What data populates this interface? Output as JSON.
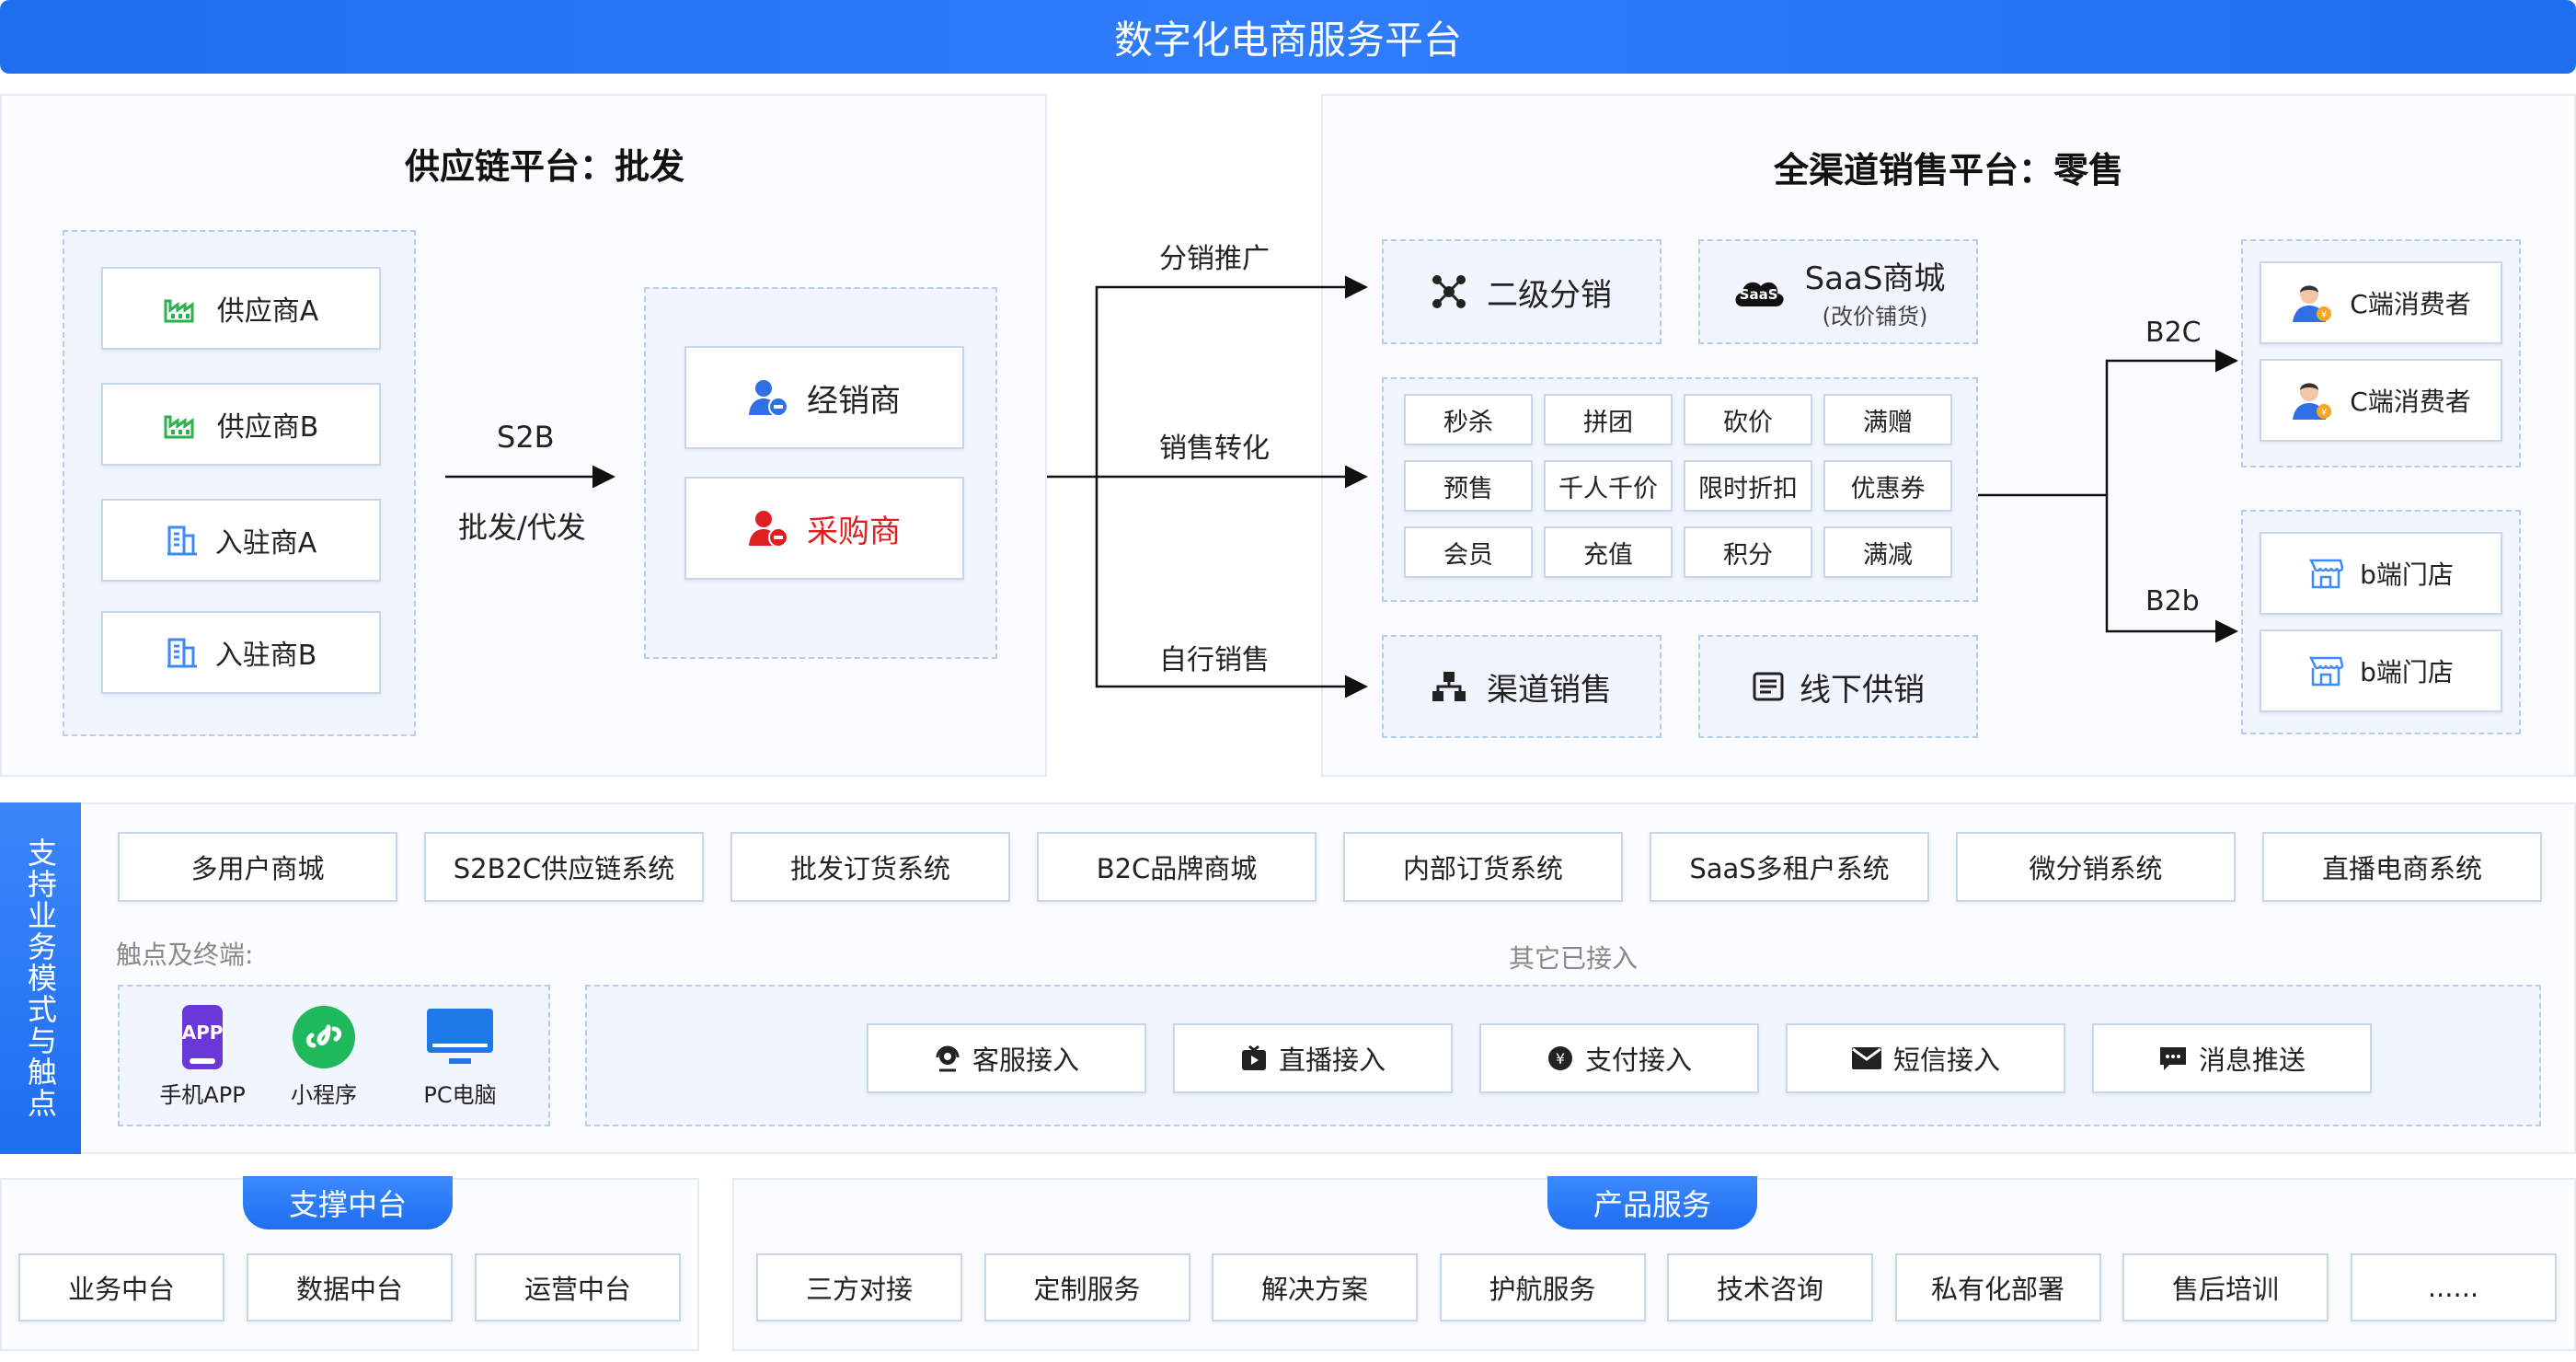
{
  "header": {
    "title": "数字化电商服务平台"
  },
  "supply": {
    "title": "供应链平台：批发",
    "suppliers": [
      "供应商A",
      "供应商B",
      "入驻商A",
      "入驻商B"
    ],
    "flow_top": "S2B",
    "flow_bottom": "批发/代发",
    "dealer": "经销商",
    "purchaser": "采购商"
  },
  "channels": {
    "distribution": "分销推广",
    "conversion": "销售转化",
    "self_sale": "自行销售"
  },
  "retail": {
    "title": "全渠道销售平台：零售",
    "second_level": "二级分销",
    "saas_title": "SaaS商城",
    "saas_sub": "(改价铺货)",
    "saas_badge": "SaaS",
    "promos": [
      "秒杀",
      "拼团",
      "砍价",
      "满赠",
      "预售",
      "千人千价",
      "限时折扣",
      "优惠券",
      "会员",
      "充值",
      "积分",
      "满减"
    ],
    "channel_sale": "渠道销售",
    "offline": "线下供销"
  },
  "targets": {
    "b2c": "B2C",
    "b2b": "B2b",
    "c_consumers": [
      "C端消费者",
      "C端消费者"
    ],
    "b_stores": [
      "b端门店",
      "b端门店"
    ]
  },
  "support": {
    "side_label": "支持业务模式与触点",
    "systems": [
      "多用户商城",
      "S2B2C供应链系统",
      "批发订货系统",
      "B2C品牌商城",
      "内部订货系统",
      "SaaS多租户系统",
      "微分销系统",
      "直播电商系统"
    ],
    "touch_label": "触点及终端:",
    "others_label": "其它已接入",
    "terminals": [
      "手机APP",
      "小程序",
      "PC电脑"
    ],
    "app_badge": "APP",
    "integrations": [
      "客服接入",
      "直播接入",
      "支付接入",
      "短信接入",
      "消息推送"
    ]
  },
  "bottom": {
    "middle_title": "支撑中台",
    "middle": [
      "业务中台",
      "数据中台",
      "运营中台"
    ],
    "service_title": "产品服务",
    "services": [
      "三方对接",
      "定制服务",
      "解决方案",
      "护航服务",
      "技术咨询",
      "私有化部署",
      "售后培训",
      "......"
    ]
  },
  "colors": {
    "brand": "#1f6ef0",
    "supplier_green": "#2bb24c",
    "purchaser_red": "#e02020",
    "consumer_orange": "#f5a623"
  }
}
